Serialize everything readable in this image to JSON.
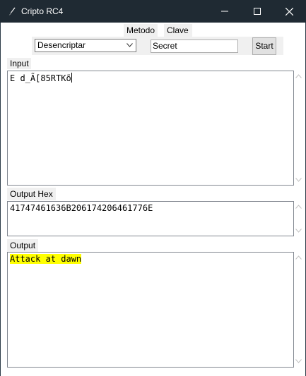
{
  "window": {
    "title": "Cripto RC4",
    "colors": {
      "titlebar": "#1f2a33",
      "highlight": "#ffff00"
    }
  },
  "header": {
    "method_label": "Metodo",
    "key_label": "Clave"
  },
  "controls": {
    "method_selected": "Desencriptar",
    "key_value": "Secret",
    "start_label": "Start"
  },
  "input": {
    "label": "Input",
    "value": "E d_Ã[85RTKõ"
  },
  "output_hex": {
    "label": "Output Hex",
    "value": "41747461636B206174206461776E"
  },
  "output": {
    "label": "Output",
    "value": "Attack at dawn"
  },
  "icons": {
    "app": "feather-icon",
    "minimize": "minimize-icon",
    "maximize": "maximize-icon",
    "close": "close-icon",
    "dropdown": "chevron-down-icon",
    "scroll_up": "scroll-up-arrow-icon",
    "scroll_down": "scroll-down-arrow-icon"
  }
}
